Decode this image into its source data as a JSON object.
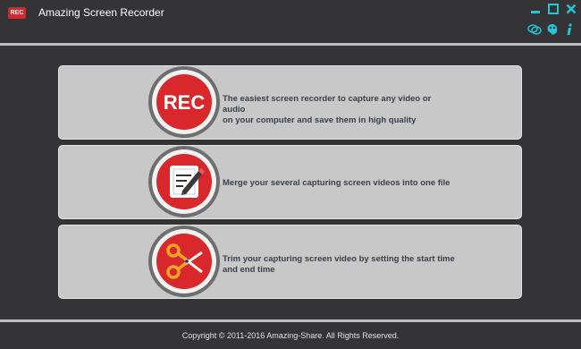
{
  "app": {
    "logo_text": "REC",
    "title": "Amazing Screen Recorder"
  },
  "window_controls": {
    "minimize_icon": "minimize-icon",
    "maximize_icon": "maximize-icon",
    "close_icon": "close-icon",
    "accent_color": "#1fc7d9"
  },
  "toolbar": {
    "icons": [
      "feedback-icon",
      "skin-icon",
      "info-icon"
    ]
  },
  "features": [
    {
      "icon": "rec-icon",
      "icon_text": "REC",
      "text": "The easiest screen recorder to capture any video or audio\n on your computer and save them in high quality"
    },
    {
      "icon": "merge-icon",
      "text": "Merge your several capturing screen videos into one file"
    },
    {
      "icon": "trim-icon",
      "text": "Trim your capturing screen video by setting the start time\nand end time"
    }
  ],
  "footer": {
    "copyright": "Copyright © 2011-2016 Amazing-Share. All Rights Reserved."
  },
  "colors": {
    "background": "#343437",
    "card": "#c8c8c8",
    "brand_red": "#d7262b"
  }
}
